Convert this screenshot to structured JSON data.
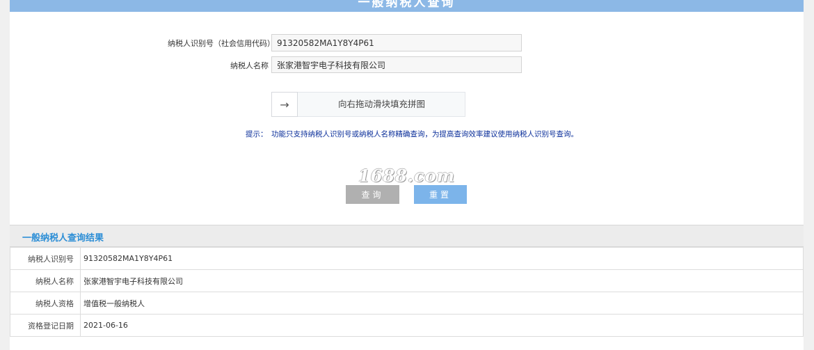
{
  "header": {
    "title": "一般纳税人查询"
  },
  "form": {
    "taxpayer_id_label": "纳税人识别号（社会信用代码）",
    "taxpayer_id_value": "91320582MA1Y8Y4P61",
    "taxpayer_name_label": "纳税人名称",
    "taxpayer_name_value": "张家港智宇电子科技有限公司"
  },
  "slider": {
    "arrow_icon": "→",
    "text": "向右拖动滑块填充拼图"
  },
  "hint": {
    "label": "提示：",
    "text": "功能只支持纳税人识别号或纳税人名称精确查询，为提高查询效率建议使用纳税人识别号查询。"
  },
  "watermark": "1688.com",
  "buttons": {
    "query": "查询",
    "reset": "重置"
  },
  "result": {
    "title": "一般纳税人查询结果",
    "rows": [
      {
        "label": "纳税人识别号",
        "value": "91320582MA1Y8Y4P61"
      },
      {
        "label": "纳税人名称",
        "value": "张家港智宇电子科技有限公司"
      },
      {
        "label": "纳税人资格",
        "value": "增值税一般纳税人"
      },
      {
        "label": "资格登记日期",
        "value": "2021-06-16"
      }
    ]
  },
  "colors": {
    "header": "#8cb8e6",
    "hint_text": "#0b2f9a",
    "query_button": "#b0b0b0",
    "reset_button": "#7cb4ea",
    "result_title": "#2c8ed6"
  }
}
